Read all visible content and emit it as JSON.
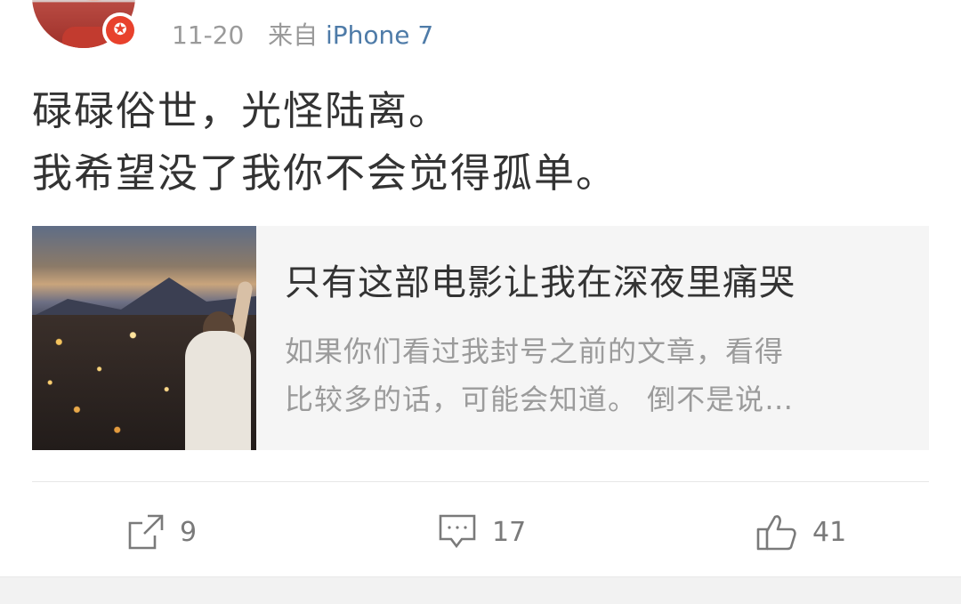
{
  "post": {
    "date": "11-20",
    "source_prefix": "来自",
    "source": "iPhone 7",
    "text_lines": [
      "碌碌俗世，光怪陆离。",
      "我希望没了我你不会觉得孤单。"
    ]
  },
  "link_card": {
    "title": "只有这部电影让我在深夜里痛哭",
    "desc_lines": [
      "如果你们看过我封号之前的文章，看得",
      "比较多的话，可能会知道。 倒不是说…"
    ]
  },
  "actions": {
    "repost": {
      "icon": "repost-icon",
      "count": "9"
    },
    "comment": {
      "icon": "comment-icon",
      "count": "17"
    },
    "like": {
      "icon": "thumbs-up-icon",
      "count": "41"
    }
  },
  "colors": {
    "text": "#333333",
    "meta": "#9a9a9a",
    "source_link": "#4e7ba8",
    "badge": "#e8412c",
    "card_bg": "#f5f5f5"
  }
}
